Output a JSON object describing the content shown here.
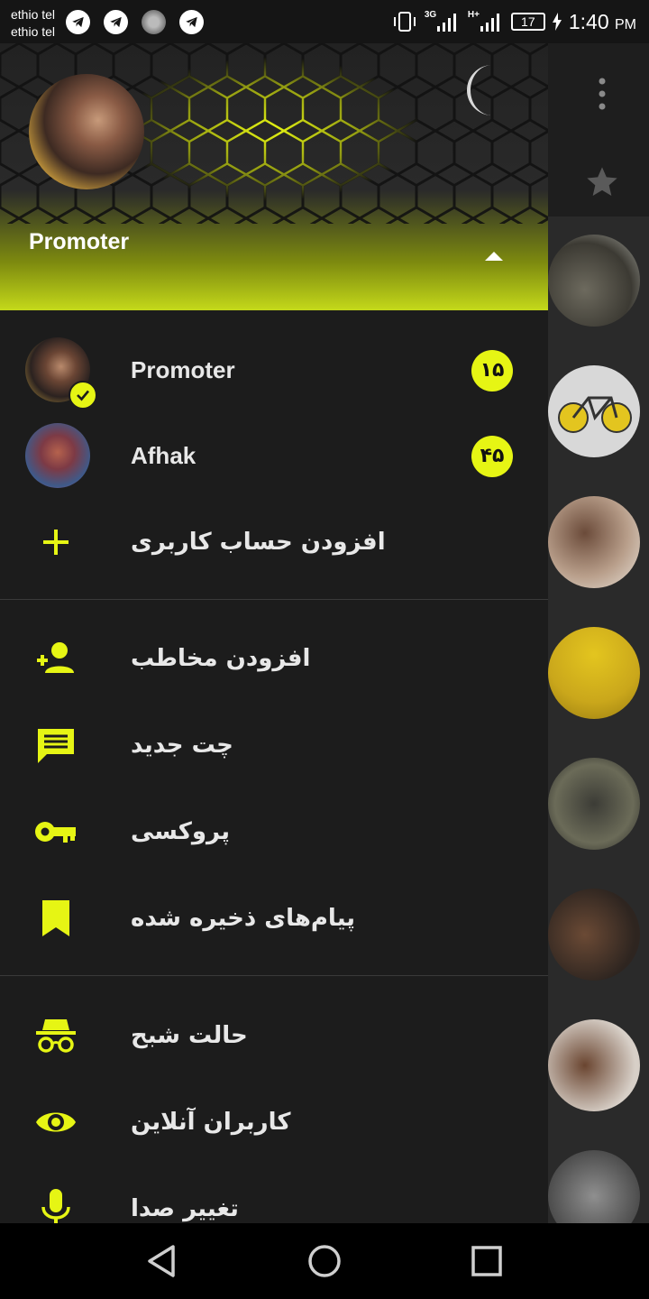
{
  "status_bar": {
    "carrier_1": "ethio tel",
    "carrier_2": "ethio tel",
    "network": "3G",
    "network_2": "H+",
    "battery": "17",
    "time": "1:40",
    "ampm": "PM",
    "notification_icons": [
      "telegram-icon",
      "telegram-icon",
      "loading-icon",
      "telegram-icon"
    ]
  },
  "drawer": {
    "header": {
      "account_name": "Promoter",
      "night_mode_icon": "moon-icon",
      "expand_icon": "chevron-up-icon"
    },
    "accounts": [
      {
        "name": "Promoter",
        "badge": "۱۵",
        "selected": true
      },
      {
        "name": "Afhak",
        "badge": "۴۵",
        "selected": false
      }
    ],
    "add_account_label": "افزودن حساب کاربری",
    "menu_group_1": [
      {
        "label": "افزودن مخاطب",
        "icon": "add-person-icon"
      },
      {
        "label": "چت جدید",
        "icon": "chat-icon"
      },
      {
        "label": "پروکسی",
        "icon": "key-icon"
      },
      {
        "label": "پیام‌های ذخیره شده",
        "icon": "bookmark-icon"
      }
    ],
    "menu_group_2": [
      {
        "label": "حالت شبح",
        "icon": "incognito-icon"
      },
      {
        "label": "کاربران آنلاین",
        "icon": "eye-icon"
      },
      {
        "label": "تغییر صدا",
        "icon": "microphone-icon"
      }
    ]
  },
  "colors": {
    "accent": "#e6f514",
    "drawer_bg": "#1c1c1c",
    "text": "#e8e8e8"
  }
}
